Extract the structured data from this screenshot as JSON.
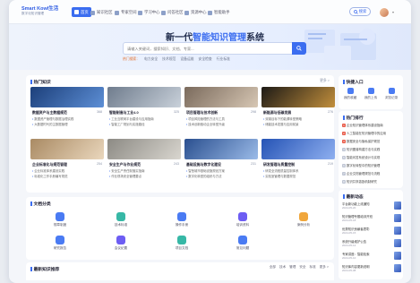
{
  "app": {
    "logo_main": "Smart Kowl生活",
    "logo_sub": "数字化知识管理"
  },
  "nav": {
    "items": [
      {
        "label": "首页"
      },
      {
        "label": "知识社区"
      },
      {
        "label": "专家空间"
      },
      {
        "label": "学习中心"
      },
      {
        "label": "问答社区"
      },
      {
        "label": "资源中心"
      },
      {
        "label": "智能助手"
      }
    ],
    "search_btn": "搜索"
  },
  "hero": {
    "title_pre": "新一代",
    "title_hl": "智能知识管理",
    "title_post": "系统",
    "search_placeholder": "请输入关键词，搜索知识、文档、专家...",
    "hot_label": "热门搜索：",
    "hot_terms": [
      "电力安全",
      "技术规范",
      "设备运维",
      "安全检查",
      "行业标准"
    ]
  },
  "popular": {
    "title": "热门知识",
    "more": "更多 >",
    "cards": [
      {
        "title": "数据资产与主数据规范",
        "num": "368",
        "lines": [
          "数据资产管理与数据治理实践",
          "大数据时代的主数据管理"
        ],
        "colors": [
          "#1c3f7a",
          "#5d8fd6"
        ]
      },
      {
        "title": "智能制造与工业4.0",
        "num": "325",
        "lines": [
          "工业互联网平台建设与应用指南",
          "智能工厂规划与实施路径"
        ],
        "colors": [
          "#6f7c8d",
          "#c9d1da"
        ]
      },
      {
        "title": "项目管理与技术创新",
        "num": "298",
        "lines": [
          "项目风险管理的方法与工具",
          "技术创新驱动企业转型升级"
        ],
        "colors": [
          "#7a6a5c",
          "#d7c7b4"
        ]
      },
      {
        "title": "新能源与低碳发展",
        "num": "276",
        "lines": [
          "双碳目标下的能源转型策略",
          "储能技术发展与应用前景"
        ],
        "colors": [
          "#1d1a16",
          "#c28f3c"
        ]
      },
      {
        "title": "企业标准化与规范管理",
        "num": "254",
        "lines": [
          "企业标准体系建设实践",
          "标准化工作手册编写规范"
        ],
        "colors": [
          "#a98a63",
          "#ead7bd"
        ]
      },
      {
        "title": "安全生产与作业规范",
        "num": "243",
        "lines": [
          "安全生产责任制落实指南",
          "作业现场安全管理要点"
        ],
        "colors": [
          "#8c8a84",
          "#d9d6cf"
        ]
      },
      {
        "title": "基础设施与数字化建设",
        "num": "231",
        "lines": [
          "智慧城市基础设施规划方案",
          "数字化转型的组织与方法"
        ],
        "colors": [
          "#2a4f8f",
          "#9bbbe8"
        ]
      },
      {
        "title": "研发管理与质量控制",
        "num": "219",
        "lines": [
          "研发全流程质量控制体系",
          "实验室管理与数据规范"
        ],
        "colors": [
          "#2553b5",
          "#8fb0f0"
        ]
      }
    ]
  },
  "quick": {
    "title": "快捷入口",
    "items": [
      {
        "label": "我的收藏"
      },
      {
        "label": "我的上传"
      },
      {
        "label": "浏览记录"
      }
    ]
  },
  "rank": {
    "title": "热门排行",
    "items": [
      {
        "n": "1",
        "t": "企业知识管理体系建设指南"
      },
      {
        "n": "2",
        "t": "人工智能在知识管理中的应用"
      },
      {
        "n": "3",
        "t": "数据安全与隐私保护规范"
      },
      {
        "n": "4",
        "t": "知识图谱构建方法与实践"
      },
      {
        "n": "5",
        "t": "智能问答系统设计与实现"
      },
      {
        "n": "6",
        "t": "数字化转型中的知识管理"
      },
      {
        "n": "7",
        "t": "企业文档管理规范与流程"
      },
      {
        "n": "8",
        "t": "知识共享激励机制研究"
      }
    ]
  },
  "news": {
    "title": "最新动态",
    "items": [
      {
        "t": "平台新功能上线通知",
        "d": "2024-05-20"
      },
      {
        "t": "知识管理专题培训开班",
        "d": "2024-05-18"
      },
      {
        "t": "优秀知识贡献者表彰",
        "d": "2024-05-15"
      },
      {
        "t": "系统升级维护公告",
        "d": "2024-05-12"
      },
      {
        "t": "专家讲座：智能检索",
        "d": "2024-05-10"
      },
      {
        "t": "知识库内容更新说明",
        "d": "2024-05-08"
      }
    ]
  },
  "docs": {
    "title": "文档分类",
    "items": [
      {
        "label": "规章制度",
        "color": "#4a7bf3"
      },
      {
        "label": "技术标准",
        "color": "#37b8a6"
      },
      {
        "label": "操作手册",
        "color": "#4a7bf3"
      },
      {
        "label": "培训资料",
        "color": "#6d5df3"
      },
      {
        "label": "案例分析",
        "color": "#f0a63b"
      },
      {
        "label": "研究报告",
        "color": "#4a7bf3"
      },
      {
        "label": "会议纪要",
        "color": "#6d5df3"
      },
      {
        "label": "项目文档",
        "color": "#37b8a6"
      },
      {
        "label": "常见问题",
        "color": "#4a7bf3"
      }
    ]
  },
  "latest": {
    "title": "最新知识推荐",
    "tabs": [
      "全部",
      "技术",
      "管理",
      "安全",
      "标准",
      "更多 >"
    ]
  }
}
